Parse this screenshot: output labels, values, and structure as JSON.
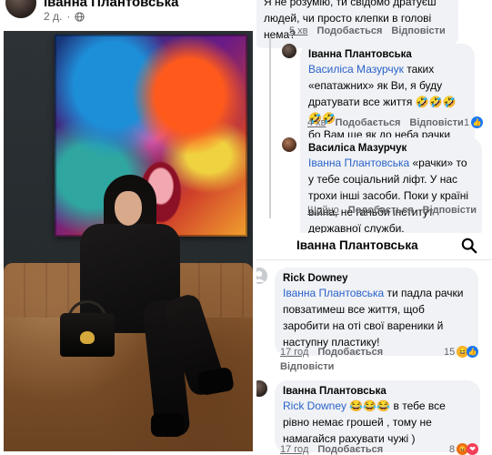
{
  "post": {
    "author": "Іванна Плантовська",
    "time": "2 д.",
    "separator": "·"
  },
  "comments_top": {
    "truncated": {
      "text": "Я не розумію, ти свідомо дратуєш людей, чи просто клепки в голові нема?",
      "time": "5 хв",
      "like": "Подобається",
      "reply": "Відповісти"
    },
    "reply1": {
      "author": "Іванна Плантовська",
      "mention": "Василіса Мазурчук",
      "text1": " таких «епатажних» як Ви, я буду дратувати все життя 🤣🤣🤣🤣🤣",
      "text2": "бо Вам ще як до неба рачки ❤️",
      "time": "4 хв",
      "like": "Подобається",
      "reply": "Відповісти",
      "reaction_count": "1"
    },
    "reply2": {
      "author": "Василіса Мазурчук",
      "mention": "Іванна Плантовська",
      "text": " «рачки» то у тебе соціальний ліфт. У нас трохи інші засоби. Поки у країні війна, не ганьби інститут державної служби.",
      "time": "Щойно",
      "like": "Подобається",
      "reply": "Відповісти"
    }
  },
  "section_header": {
    "title": "Іванна Плантовська"
  },
  "comments_bottom": {
    "comment1": {
      "author": "Rick Downey",
      "mention": "Іванна Плантовська",
      "text": " ти падла рачки повзатимеш все життя, щоб заробити на оті свої вареники й наступну пластику!",
      "time": "17 год",
      "like": "Подобається",
      "reply": "Відповісти",
      "reaction_count": "15"
    },
    "comment2": {
      "author": "Іванна Плантовська",
      "mention": "Rick Downey",
      "text": " 😂😂😂 в тебе все рівно немає грошей , тому не намагайся рахувати чужі )",
      "time": "17 год",
      "like": "Подобається",
      "reaction_count": "8"
    }
  },
  "colors": {
    "mention": "#2a62c9",
    "bubble": "#f0f2f5",
    "meta": "#65676b",
    "like_blue": "#1877f2",
    "love_red": "#f33e58",
    "haha_yellow": "#f7b125"
  }
}
